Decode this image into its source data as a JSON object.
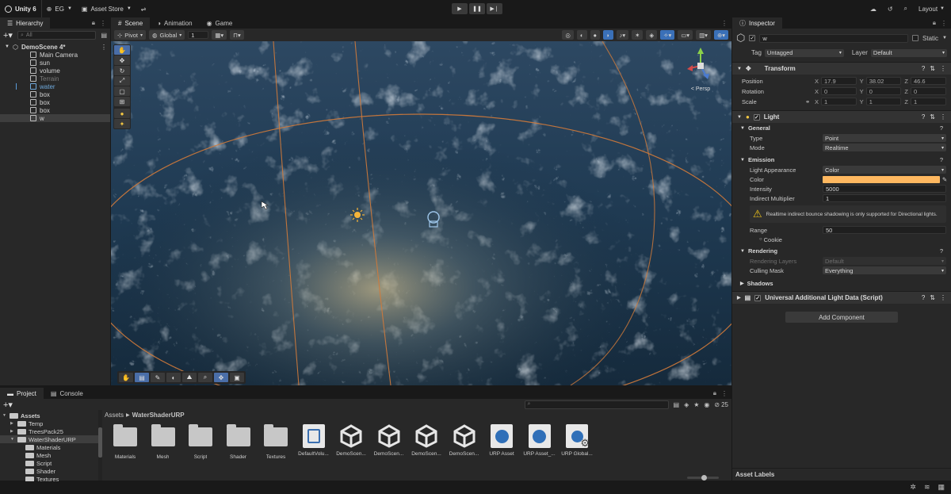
{
  "topbar": {
    "app_name": "Unity 6",
    "account": "EG",
    "asset_store": "Asset Store",
    "layout": "Layout"
  },
  "hierarchy": {
    "tab": "Hierarchy",
    "search_placeholder": "All",
    "scene_name": "DemoScene 4*",
    "items": [
      {
        "label": "Main Camera",
        "selected": false,
        "dim": false
      },
      {
        "label": "sun",
        "selected": false,
        "dim": false
      },
      {
        "label": "volume",
        "selected": false,
        "dim": false
      },
      {
        "label": "Terrain",
        "selected": false,
        "dim": true
      },
      {
        "label": "water",
        "selected": false,
        "dim": false,
        "blue": true
      },
      {
        "label": "box",
        "selected": false,
        "dim": false
      },
      {
        "label": "box",
        "selected": false,
        "dim": false
      },
      {
        "label": "box",
        "selected": false,
        "dim": false
      },
      {
        "label": "w",
        "selected": true,
        "dim": false
      }
    ]
  },
  "scene": {
    "tabs": [
      "Scene",
      "Animation",
      "Game"
    ],
    "pivot": "Pivot",
    "global": "Global",
    "grid_value": "1",
    "persp_label": "< Persp"
  },
  "inspector": {
    "tab": "Inspector",
    "object_name": "w",
    "static_label": "Static",
    "tag_label": "Tag",
    "tag_value": "Untagged",
    "layer_label": "Layer",
    "layer_value": "Default",
    "transform": {
      "title": "Transform",
      "position_label": "Position",
      "rotation_label": "Rotation",
      "scale_label": "Scale",
      "position": [
        "17.9",
        "38.02",
        "46.6"
      ],
      "rotation": [
        "0",
        "0",
        "0"
      ],
      "scale": [
        "1",
        "1",
        "1"
      ]
    },
    "light": {
      "title": "Light",
      "general": "General",
      "type_label": "Type",
      "type_value": "Point",
      "mode_label": "Mode",
      "mode_value": "Realtime",
      "emission": "Emission",
      "appearance_label": "Light Appearance",
      "appearance_value": "Color",
      "color_label": "Color",
      "color_value": "#ffb860",
      "intensity_label": "Intensity",
      "intensity_value": "5000",
      "indirect_label": "Indirect Multiplier",
      "indirect_value": "1",
      "warning": "Realtime indirect bounce shadowing is only supported for Directional lights.",
      "range_label": "Range",
      "range_value": "50",
      "cookie_label": "Cookie",
      "rendering": "Rendering",
      "rendering_layers_label": "Rendering Layers",
      "rendering_layers_value": "Default",
      "culling_label": "Culling Mask",
      "culling_value": "Everything",
      "shadows": "Shadows"
    },
    "urp_component": "Universal Additional Light Data (Script)",
    "add_component": "Add Component",
    "asset_labels": "Asset Labels"
  },
  "project": {
    "tabs": [
      "Project",
      "Console"
    ],
    "tree": [
      {
        "label": "Assets",
        "level": 0,
        "bold": true
      },
      {
        "label": "Temp",
        "level": 1
      },
      {
        "label": "TreesPack25",
        "level": 1
      },
      {
        "label": "WaterShaderURP",
        "level": 1,
        "selected": true
      },
      {
        "label": "Materials",
        "level": 2
      },
      {
        "label": "Mesh",
        "level": 2
      },
      {
        "label": "Script",
        "level": 2
      },
      {
        "label": "Shader",
        "level": 2
      },
      {
        "label": "Textures",
        "level": 2
      }
    ],
    "breadcrumb_root": "Assets",
    "breadcrumb_current": "WaterShaderURP",
    "count": "25",
    "assets": [
      {
        "name": "Materials",
        "kind": "folder"
      },
      {
        "name": "Mesh",
        "kind": "folder"
      },
      {
        "name": "Script",
        "kind": "folder"
      },
      {
        "name": "Shader",
        "kind": "folder"
      },
      {
        "name": "Textures",
        "kind": "folder"
      },
      {
        "name": "DefaultVolu...",
        "kind": "volume"
      },
      {
        "name": "DemoScen...",
        "kind": "unity"
      },
      {
        "name": "DemoScen...",
        "kind": "unity"
      },
      {
        "name": "DemoScen...",
        "kind": "unity"
      },
      {
        "name": "DemoScen...",
        "kind": "unity"
      },
      {
        "name": "URP Asset",
        "kind": "urp"
      },
      {
        "name": "URP Asset_...",
        "kind": "urp"
      },
      {
        "name": "URP Global...",
        "kind": "urpsettings"
      }
    ]
  },
  "colors": {
    "accent": "#3a70b8",
    "light_color": "#ffb860",
    "warning": "#f0c419"
  }
}
